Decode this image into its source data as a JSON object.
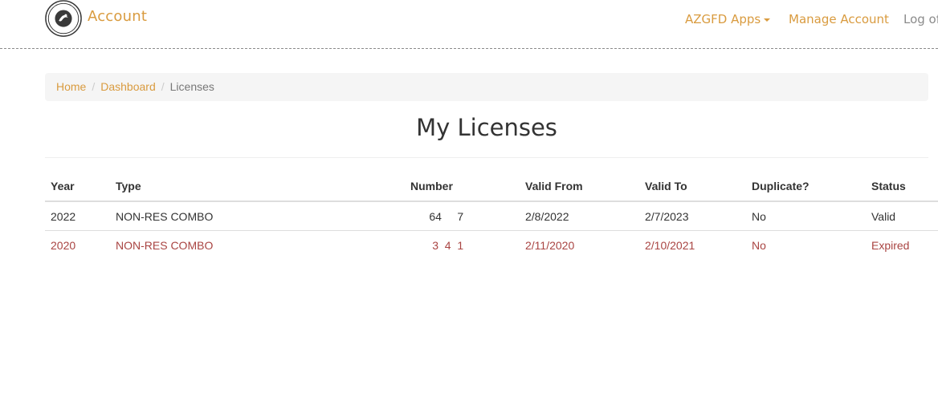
{
  "header": {
    "brand": "Account",
    "nav": {
      "apps": "AZGFD Apps",
      "manage": "Manage Account",
      "logout": "Log of"
    }
  },
  "breadcrumb": {
    "home": "Home",
    "dashboard": "Dashboard",
    "current": "Licenses"
  },
  "page": {
    "title": "My Licenses"
  },
  "table": {
    "columns": [
      "Year",
      "Type",
      "Number",
      "Valid From",
      "Valid To",
      "Duplicate?",
      "Status"
    ],
    "rows": [
      {
        "year": "2022",
        "type": "NON-RES COMBO",
        "number": "      64     7",
        "valid_from": "2/8/2022",
        "valid_to": "2/7/2023",
        "duplicate": "No",
        "status": "Valid"
      },
      {
        "year": "2020",
        "type": "NON-RES COMBO",
        "number": "       3  4  1",
        "valid_from": "2/11/2020",
        "valid_to": "2/10/2021",
        "duplicate": "No",
        "status": "Expired"
      }
    ]
  },
  "colors": {
    "accent": "#d99b3f",
    "expired": "#a94442",
    "text": "#333333"
  },
  "icons": {
    "logo": "arizona-game-and-fish-logo",
    "apps_dropdown": "caret-down-icon"
  }
}
